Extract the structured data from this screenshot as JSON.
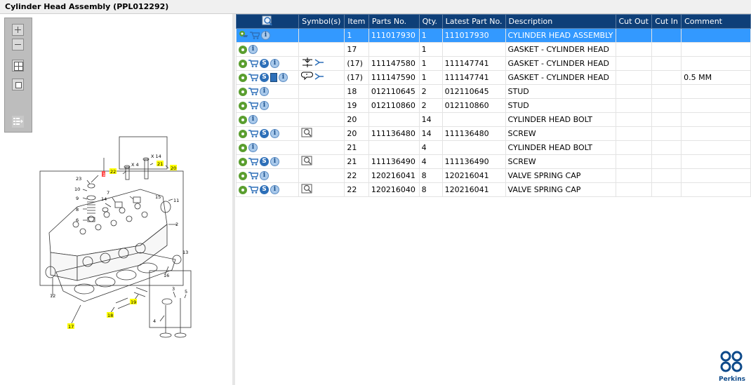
{
  "window": {
    "title": "Cylinder Head Assembly (PPL012292)"
  },
  "toolbar": {
    "buttons": [
      "zoom-in",
      "zoom-out",
      "fit-all",
      "fit-window",
      "export-list"
    ]
  },
  "diagram": {
    "callouts": [
      "1",
      "2",
      "3",
      "4",
      "5",
      "6",
      "7",
      "8",
      "9",
      "10",
      "11",
      "12",
      "13",
      "14",
      "15",
      "16",
      "17",
      "18",
      "19",
      "20",
      "21",
      "22",
      "23",
      "X 4",
      "X 14"
    ],
    "highlight_color": "#ffff00"
  },
  "table": {
    "columns": [
      "",
      "Symbol(s)",
      "Item",
      "Parts No.",
      "Qty.",
      "Latest Part No.",
      "Description",
      "Cut Out",
      "Cut In",
      "Comment"
    ],
    "rows": [
      {
        "icons": [
          "gear-cart",
          "cart",
          "info"
        ],
        "symbols": [],
        "item": "1",
        "part": "111017930",
        "qty": "1",
        "latest": "111017930",
        "desc": "CYLINDER HEAD ASSEMBLY",
        "cut_out": "",
        "cut_in": "",
        "comment": "",
        "selected": true
      },
      {
        "icons": [
          "gear",
          "info"
        ],
        "symbols": [],
        "item": "17",
        "part": "",
        "qty": "1",
        "latest": "",
        "desc": "GASKET - CYLINDER HEAD",
        "cut_out": "",
        "cut_in": "",
        "comment": ""
      },
      {
        "icons": [
          "gear",
          "cart",
          "s",
          "info"
        ],
        "symbols": [
          "split-arrows"
        ],
        "item": "(17)",
        "part": "111147580",
        "qty": "1",
        "latest": "111147741",
        "desc": "GASKET - CYLINDER HEAD",
        "cut_out": "",
        "cut_in": "",
        "comment": ""
      },
      {
        "icons": [
          "gear",
          "cart",
          "s",
          "book",
          "info"
        ],
        "symbols": [
          "comment-arrows"
        ],
        "item": "(17)",
        "part": "111147590",
        "qty": "1",
        "latest": "111147741",
        "desc": "GASKET - CYLINDER HEAD",
        "cut_out": "",
        "cut_in": "",
        "comment": "0.5 MM"
      },
      {
        "icons": [
          "gear",
          "cart",
          "info"
        ],
        "symbols": [],
        "item": "18",
        "part": "012110645",
        "qty": "2",
        "latest": "012110645",
        "desc": "STUD",
        "cut_out": "",
        "cut_in": "",
        "comment": ""
      },
      {
        "icons": [
          "gear",
          "cart",
          "info"
        ],
        "symbols": [],
        "item": "19",
        "part": "012110860",
        "qty": "2",
        "latest": "012110860",
        "desc": "STUD",
        "cut_out": "",
        "cut_in": "",
        "comment": ""
      },
      {
        "icons": [
          "gear",
          "info"
        ],
        "symbols": [],
        "item": "20",
        "part": "",
        "qty": "14",
        "latest": "",
        "desc": "CYLINDER HEAD BOLT",
        "cut_out": "",
        "cut_in": "",
        "comment": ""
      },
      {
        "icons": [
          "gear",
          "cart",
          "s",
          "info"
        ],
        "symbols": [
          "magnifier-book"
        ],
        "item": "20",
        "part": "111136480",
        "qty": "14",
        "latest": "111136480",
        "desc": "SCREW",
        "cut_out": "",
        "cut_in": "",
        "comment": ""
      },
      {
        "icons": [
          "gear",
          "info"
        ],
        "symbols": [],
        "item": "21",
        "part": "",
        "qty": "4",
        "latest": "",
        "desc": "CYLINDER HEAD BOLT",
        "cut_out": "",
        "cut_in": "",
        "comment": ""
      },
      {
        "icons": [
          "gear",
          "cart",
          "s",
          "info"
        ],
        "symbols": [
          "magnifier-book"
        ],
        "item": "21",
        "part": "111136490",
        "qty": "4",
        "latest": "111136490",
        "desc": "SCREW",
        "cut_out": "",
        "cut_in": "",
        "comment": ""
      },
      {
        "icons": [
          "gear",
          "cart",
          "info"
        ],
        "symbols": [],
        "item": "22",
        "part": "120216041",
        "qty": "8",
        "latest": "120216041",
        "desc": "VALVE SPRING CAP",
        "cut_out": "",
        "cut_in": "",
        "comment": ""
      },
      {
        "icons": [
          "gear",
          "cart",
          "s",
          "info"
        ],
        "symbols": [
          "magnifier-book"
        ],
        "item": "22",
        "part": "120216040",
        "qty": "8",
        "latest": "120216041",
        "desc": "VALVE SPRING CAP",
        "cut_out": "",
        "cut_in": "",
        "comment": ""
      }
    ]
  },
  "brand": {
    "name": "Perkins",
    "color": "#0e4a8a"
  },
  "colors": {
    "header_bg": "#0e3f78",
    "selected_row": "#3399ff"
  }
}
